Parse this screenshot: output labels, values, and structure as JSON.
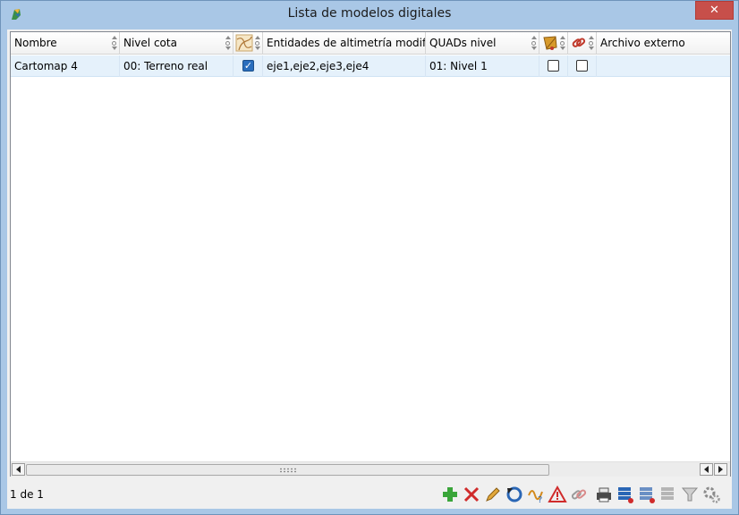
{
  "window": {
    "title": "Lista de modelos digitales",
    "close_symbol": "✕"
  },
  "table": {
    "columns": [
      {
        "label": "Nombre",
        "icon": null
      },
      {
        "label": "Nivel cota",
        "icon": null
      },
      {
        "label": "",
        "icon": "map-contours-icon"
      },
      {
        "label": "Entidades de altimetría modific...",
        "icon": null
      },
      {
        "label": "QUADs nivel",
        "icon": null
      },
      {
        "label": "",
        "icon": "quad-leaf-icon"
      },
      {
        "label": "",
        "icon": "link-icon"
      },
      {
        "label": "Archivo externo",
        "icon": null
      }
    ],
    "rows": [
      {
        "nombre": "Cartomap 4",
        "nivel_cota": "00: Terreno real",
        "flag1_checked": true,
        "entidades": "eje1,eje2,eje3,eje4",
        "quads_nivel": "01: Nivel 1",
        "flag2_checked": false,
        "flag3_checked": false,
        "archivo_externo": ""
      }
    ]
  },
  "status": {
    "page_text": "1 de 1"
  },
  "toolbar": {
    "icons": [
      "add-icon",
      "delete-icon",
      "edit-icon",
      "refresh-icon",
      "check-entities-icon",
      "warning-icon",
      "link-tool-icon",
      "print-icon",
      "list-export-icon",
      "list-import-icon",
      "list-settings-icon",
      "filter-icon",
      "settings-icon"
    ]
  },
  "colors": {
    "title_bar": "#a9c7e6",
    "selection": "#e5f1fb",
    "close_button": "#c74f4a"
  }
}
